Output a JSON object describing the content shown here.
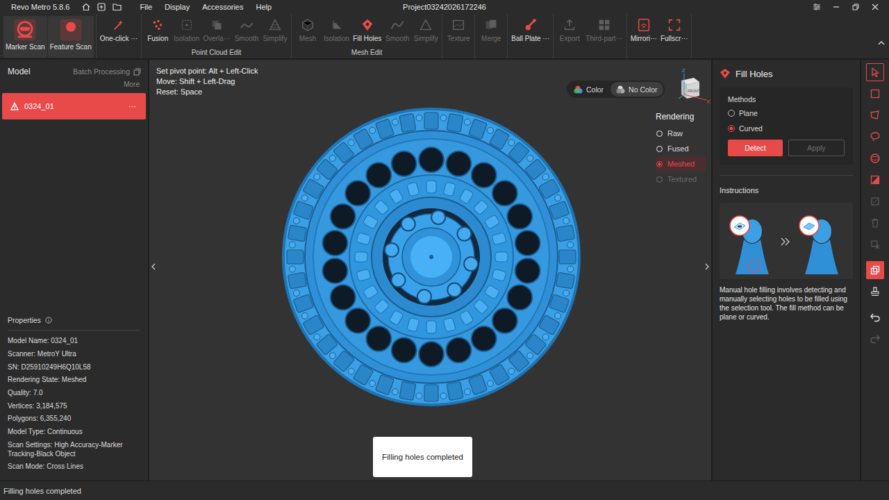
{
  "window": {
    "app": "Revo Metro 5.8.6",
    "title": "Project03242026172246"
  },
  "menu": [
    "File",
    "Display",
    "Accessories",
    "Help"
  ],
  "toolbar": {
    "sections": [
      {
        "label": "",
        "items": [
          {
            "label": "Marker Scan",
            "disabled": false
          },
          {
            "label": "Feature Scan",
            "disabled": false
          }
        ]
      },
      {
        "label": "",
        "items": [
          {
            "label": "One-click ···",
            "disabled": false
          }
        ]
      },
      {
        "label": "Point Cloud Edit",
        "items": [
          {
            "label": "Fusion",
            "disabled": false
          },
          {
            "label": "Isolation",
            "disabled": true
          },
          {
            "label": "Overla···",
            "disabled": true
          },
          {
            "label": "Smooth",
            "disabled": true
          },
          {
            "label": "Simplify",
            "disabled": true
          }
        ]
      },
      {
        "label": "Mesh Edit",
        "items": [
          {
            "label": "Mesh",
            "disabled": true
          },
          {
            "label": "Isolation",
            "disabled": true
          },
          {
            "label": "Fill Holes",
            "disabled": false
          },
          {
            "label": "Smooth",
            "disabled": true
          },
          {
            "label": "Simplify",
            "disabled": true
          }
        ]
      },
      {
        "label": "",
        "items": [
          {
            "label": "Texture",
            "disabled": true
          }
        ]
      },
      {
        "label": "",
        "items": [
          {
            "label": "Merge",
            "disabled": true
          }
        ]
      },
      {
        "label": "",
        "items": [
          {
            "label": "Ball Plate ···",
            "disabled": false
          }
        ]
      },
      {
        "label": "",
        "items": [
          {
            "label": "Export",
            "disabled": true
          },
          {
            "label": "Third-part···",
            "disabled": true
          }
        ]
      },
      {
        "label": "",
        "items": [
          {
            "label": "Mirrori···",
            "disabled": false
          },
          {
            "label": "Fullscr···",
            "disabled": false
          }
        ]
      }
    ]
  },
  "left_panel": {
    "title": "Model",
    "batch": "Batch Processing",
    "more": "More",
    "models": [
      {
        "name": "0324_01",
        "menu": "···",
        "selected": true
      }
    ],
    "properties_title": "Properties",
    "properties": [
      {
        "label": "Model Name:",
        "value": "0324_01"
      },
      {
        "label": "Scanner:",
        "value": "MetroY Ultra"
      },
      {
        "label": "SN:",
        "value": "D25910249H6Q10L58"
      },
      {
        "label": "Rendering State:",
        "value": "Meshed"
      },
      {
        "label": "Quality:",
        "value": "7.0"
      },
      {
        "label": "Vertices:",
        "value": "3,184,575"
      },
      {
        "label": "Polygons:",
        "value": "6,355,240"
      },
      {
        "label": "Model Type:",
        "value": "Continuous"
      },
      {
        "label": "Scan Settings:",
        "value": "High Accuracy-Marker Tracking-Black Object"
      },
      {
        "label": "Scan Mode:",
        "value": "Cross Lines"
      }
    ]
  },
  "viewport": {
    "hints": [
      "Set pivot point: Alt + Left-Click",
      "Move: Shift + Left-Drag",
      "Reset: Space"
    ],
    "color_toggle": [
      {
        "label": "Color",
        "selected": false
      },
      {
        "label": "No Color",
        "selected": true
      }
    ],
    "axes": {
      "z": "Z",
      "x": "X",
      "face": "FRONT"
    },
    "rendering": {
      "title": "Rendering",
      "options": [
        {
          "label": "Raw",
          "selected": false,
          "disabled": false
        },
        {
          "label": "Fused",
          "selected": false,
          "disabled": false
        },
        {
          "label": "Meshed",
          "selected": true,
          "disabled": false
        },
        {
          "label": "Textured",
          "selected": false,
          "disabled": true
        }
      ]
    },
    "toast": "Filling holes completed"
  },
  "right_panel": {
    "title": "Fill Holes",
    "methods_title": "Methods",
    "methods": [
      {
        "label": "Plane",
        "selected": false
      },
      {
        "label": "Curved",
        "selected": true
      }
    ],
    "buttons": [
      {
        "label": "Detect",
        "disabled": false
      },
      {
        "label": "Apply",
        "disabled": true
      }
    ],
    "instructions_title": "Instructions",
    "instructions": "Manual hole filling involves detecting and manually selecting holes to be filled using the selection tool. The fill method can be plane or curved."
  },
  "right_tools": [
    {
      "selected": true,
      "on": false,
      "disabled": false
    },
    {
      "selected": false,
      "on": false,
      "disabled": false
    },
    {
      "selected": false,
      "on": false,
      "disabled": false
    },
    {
      "selected": false,
      "on": false,
      "disabled": false
    },
    {
      "selected": false,
      "on": false,
      "disabled": false
    },
    {
      "selected": false,
      "on": false,
      "disabled": false
    },
    {
      "selected": false,
      "on": false,
      "disabled": true
    },
    {
      "selected": false,
      "on": false,
      "disabled": true
    },
    {
      "selected": false,
      "on": false,
      "disabled": true
    },
    {
      "selected": false,
      "on": true,
      "disabled": false
    },
    {
      "selected": false,
      "on": false,
      "disabled": false
    },
    {
      "selected": false,
      "on": false,
      "disabled": false
    },
    {
      "selected": false,
      "on": false,
      "disabled": true
    }
  ],
  "status_bar": "Filling holes completed"
}
